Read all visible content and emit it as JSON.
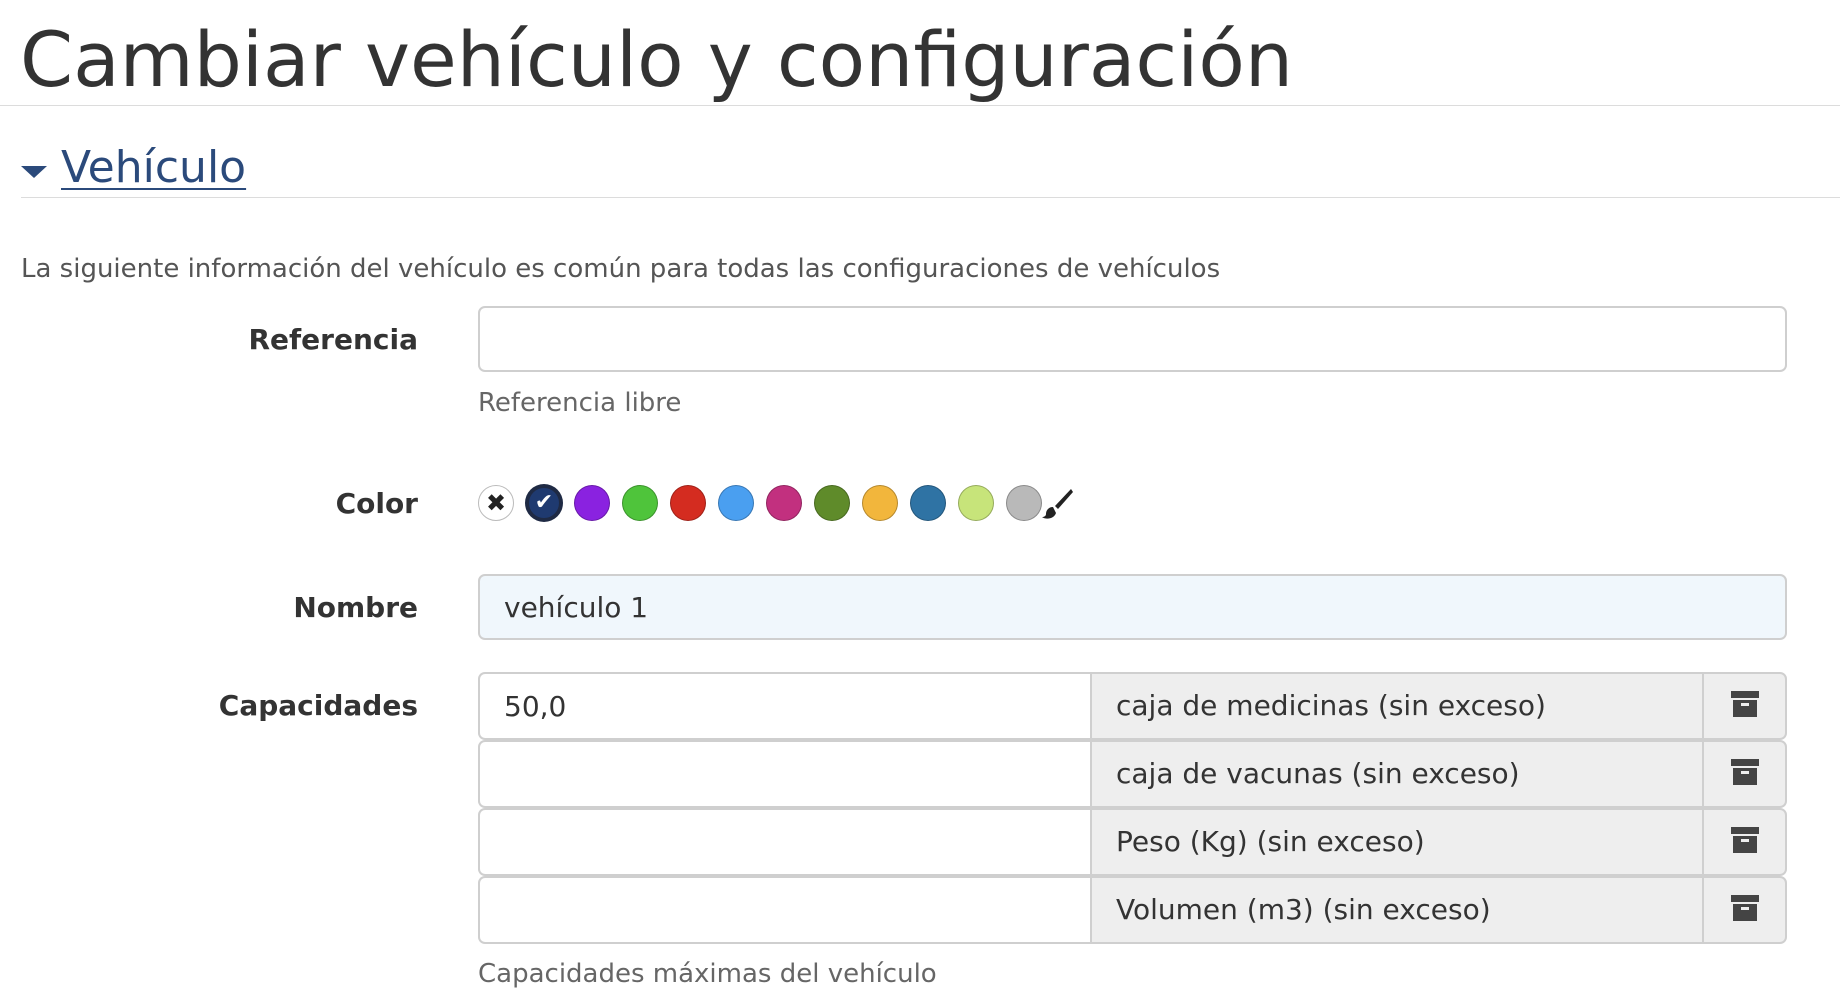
{
  "page": {
    "title": "Cambiar vehículo y configuración"
  },
  "section": {
    "label": "Vehículo",
    "expanded": true,
    "intro": "La siguiente información del vehículo es común para todas las configuraciones de vehículos"
  },
  "reference": {
    "label": "Referencia",
    "value": "",
    "help": "Referencia libre"
  },
  "color": {
    "label": "Color",
    "selected_index": 1,
    "swatches": [
      {
        "name": "none",
        "hex": "#ffffff",
        "icon": "close-icon"
      },
      {
        "name": "navy",
        "hex": "#1f3a70",
        "icon": "check-icon"
      },
      {
        "name": "purple",
        "hex": "#8a22e0"
      },
      {
        "name": "green",
        "hex": "#4fc43b"
      },
      {
        "name": "red",
        "hex": "#d42c20"
      },
      {
        "name": "sky-blue",
        "hex": "#4a9ff0"
      },
      {
        "name": "magenta",
        "hex": "#c2307f"
      },
      {
        "name": "olive-green",
        "hex": "#5f8b2a"
      },
      {
        "name": "amber",
        "hex": "#f2b63c"
      },
      {
        "name": "steel-blue",
        "hex": "#2f73a4"
      },
      {
        "name": "light-green",
        "hex": "#c7e47a"
      },
      {
        "name": "gray",
        "hex": "#b9b9b9"
      }
    ],
    "custom_icon": "paint-brush-icon"
  },
  "name": {
    "label": "Nombre",
    "value": "vehículo 1"
  },
  "capacities": {
    "label": "Capacidades",
    "help": "Capacidades máximas del vehículo",
    "rows": [
      {
        "value": "50,0",
        "unit": "caja de medicinas (sin exceso)"
      },
      {
        "value": "",
        "unit": "caja de vacunas (sin exceso)"
      },
      {
        "value": "",
        "unit": "Peso (Kg) (sin exceso)"
      },
      {
        "value": "",
        "unit": "Volumen (m3) (sin exceso)"
      }
    ],
    "row_icon": "archive-icon"
  }
}
